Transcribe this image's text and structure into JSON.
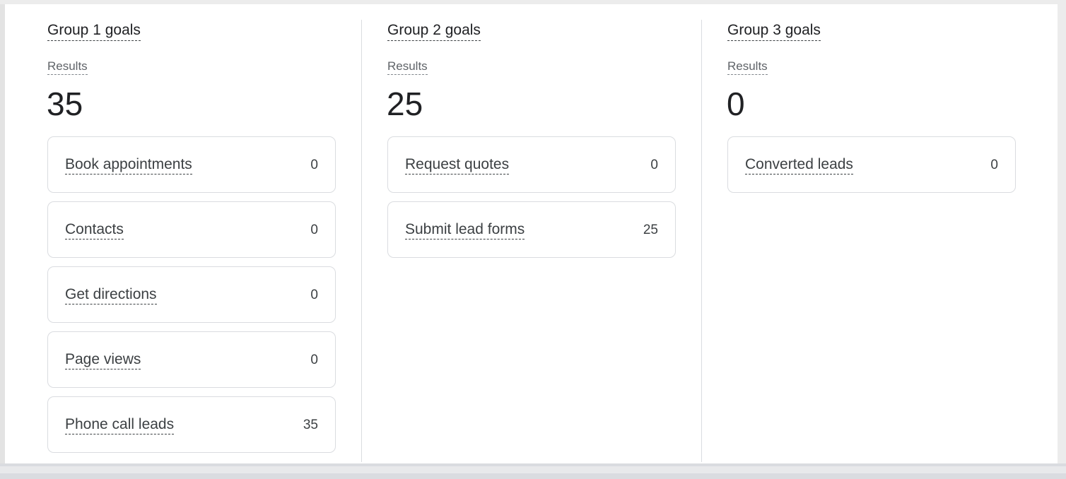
{
  "groups": [
    {
      "title": "Group 1 goals",
      "results_label": "Results",
      "results_value": "35",
      "goals": [
        {
          "name": "Book appointments",
          "value": "0"
        },
        {
          "name": "Contacts",
          "value": "0"
        },
        {
          "name": "Get directions",
          "value": "0"
        },
        {
          "name": "Page views",
          "value": "0"
        },
        {
          "name": "Phone call leads",
          "value": "35"
        }
      ]
    },
    {
      "title": "Group 2 goals",
      "results_label": "Results",
      "results_value": "25",
      "goals": [
        {
          "name": "Request quotes",
          "value": "0"
        },
        {
          "name": "Submit lead forms",
          "value": "25"
        }
      ]
    },
    {
      "title": "Group 3 goals",
      "results_label": "Results",
      "results_value": "0",
      "goals": [
        {
          "name": "Converted leads",
          "value": "0"
        }
      ]
    }
  ]
}
